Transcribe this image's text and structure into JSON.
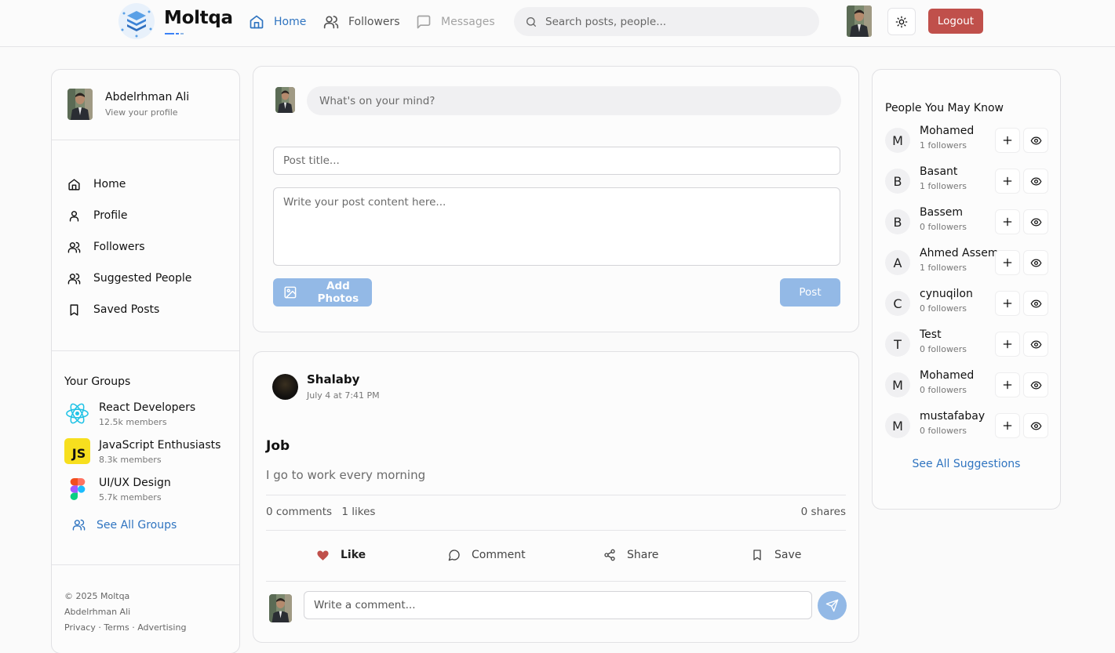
{
  "app": {
    "name": "Moltqa"
  },
  "nav": {
    "home": "Home",
    "followers": "Followers",
    "messages": "Messages",
    "search_placeholder": "Search posts, people...",
    "logout": "Logout"
  },
  "user": {
    "name": "Abdelrhman Ali",
    "sub": "View your profile"
  },
  "menu": [
    {
      "label": "Home",
      "icon": "home-icon"
    },
    {
      "label": "Profile",
      "icon": "user-icon"
    },
    {
      "label": "Followers",
      "icon": "users-icon"
    },
    {
      "label": "Suggested People",
      "icon": "users-icon"
    },
    {
      "label": "Saved Posts",
      "icon": "bookmark-icon"
    }
  ],
  "groups": {
    "title": "Your Groups",
    "items": [
      {
        "name": "React Developers",
        "members": "12.5k members",
        "icon": "react-icon"
      },
      {
        "name": "JavaScript Enthusiasts",
        "members": "8.3k members",
        "icon": "javascript-icon",
        "badge": "JS"
      },
      {
        "name": "UI/UX Design",
        "members": "5.7k members",
        "icon": "figma-icon"
      }
    ],
    "see_all": "See All Groups"
  },
  "footer": {
    "copyright": "© 2025 Moltqa",
    "author": "Abdelrhman Ali",
    "links": "Privacy · Terms · Advertising"
  },
  "composer": {
    "mind_placeholder": "What's on your mind?",
    "title_placeholder": "Post title...",
    "content_placeholder": "Write your post content here...",
    "add_photos": "Add Photos",
    "post": "Post"
  },
  "post": {
    "author": "Shalaby",
    "time": "July 4 at 7:41 PM",
    "title": "Job",
    "body": "I go to work every morning",
    "comments": "0 comments",
    "likes": "1 likes",
    "shares": "0 shares",
    "actions": {
      "like": "Like",
      "comment": "Comment",
      "share": "Share",
      "save": "Save"
    },
    "comment_placeholder": "Write a comment..."
  },
  "suggestions": {
    "title": "People You May Know",
    "people": [
      {
        "initial": "M",
        "name": "Mohamed",
        "followers": "1 followers"
      },
      {
        "initial": "B",
        "name": "Basant",
        "followers": "1 followers"
      },
      {
        "initial": "B",
        "name": "Bassem",
        "followers": "0 followers"
      },
      {
        "initial": "A",
        "name": "Ahmed Assem",
        "followers": "1 followers"
      },
      {
        "initial": "C",
        "name": "cynuqilon",
        "followers": "0 followers"
      },
      {
        "initial": "T",
        "name": "Test",
        "followers": "0 followers"
      },
      {
        "initial": "M",
        "name": "Mohamed",
        "followers": "0 followers"
      },
      {
        "initial": "M",
        "name": "mustafabay",
        "followers": "0 followers"
      }
    ],
    "see_all": "See All Suggestions"
  },
  "colors": {
    "accent": "#2f74c0",
    "logout": "#c0504b",
    "button_disabled": "#93b9e6",
    "like": "#c0504b"
  }
}
